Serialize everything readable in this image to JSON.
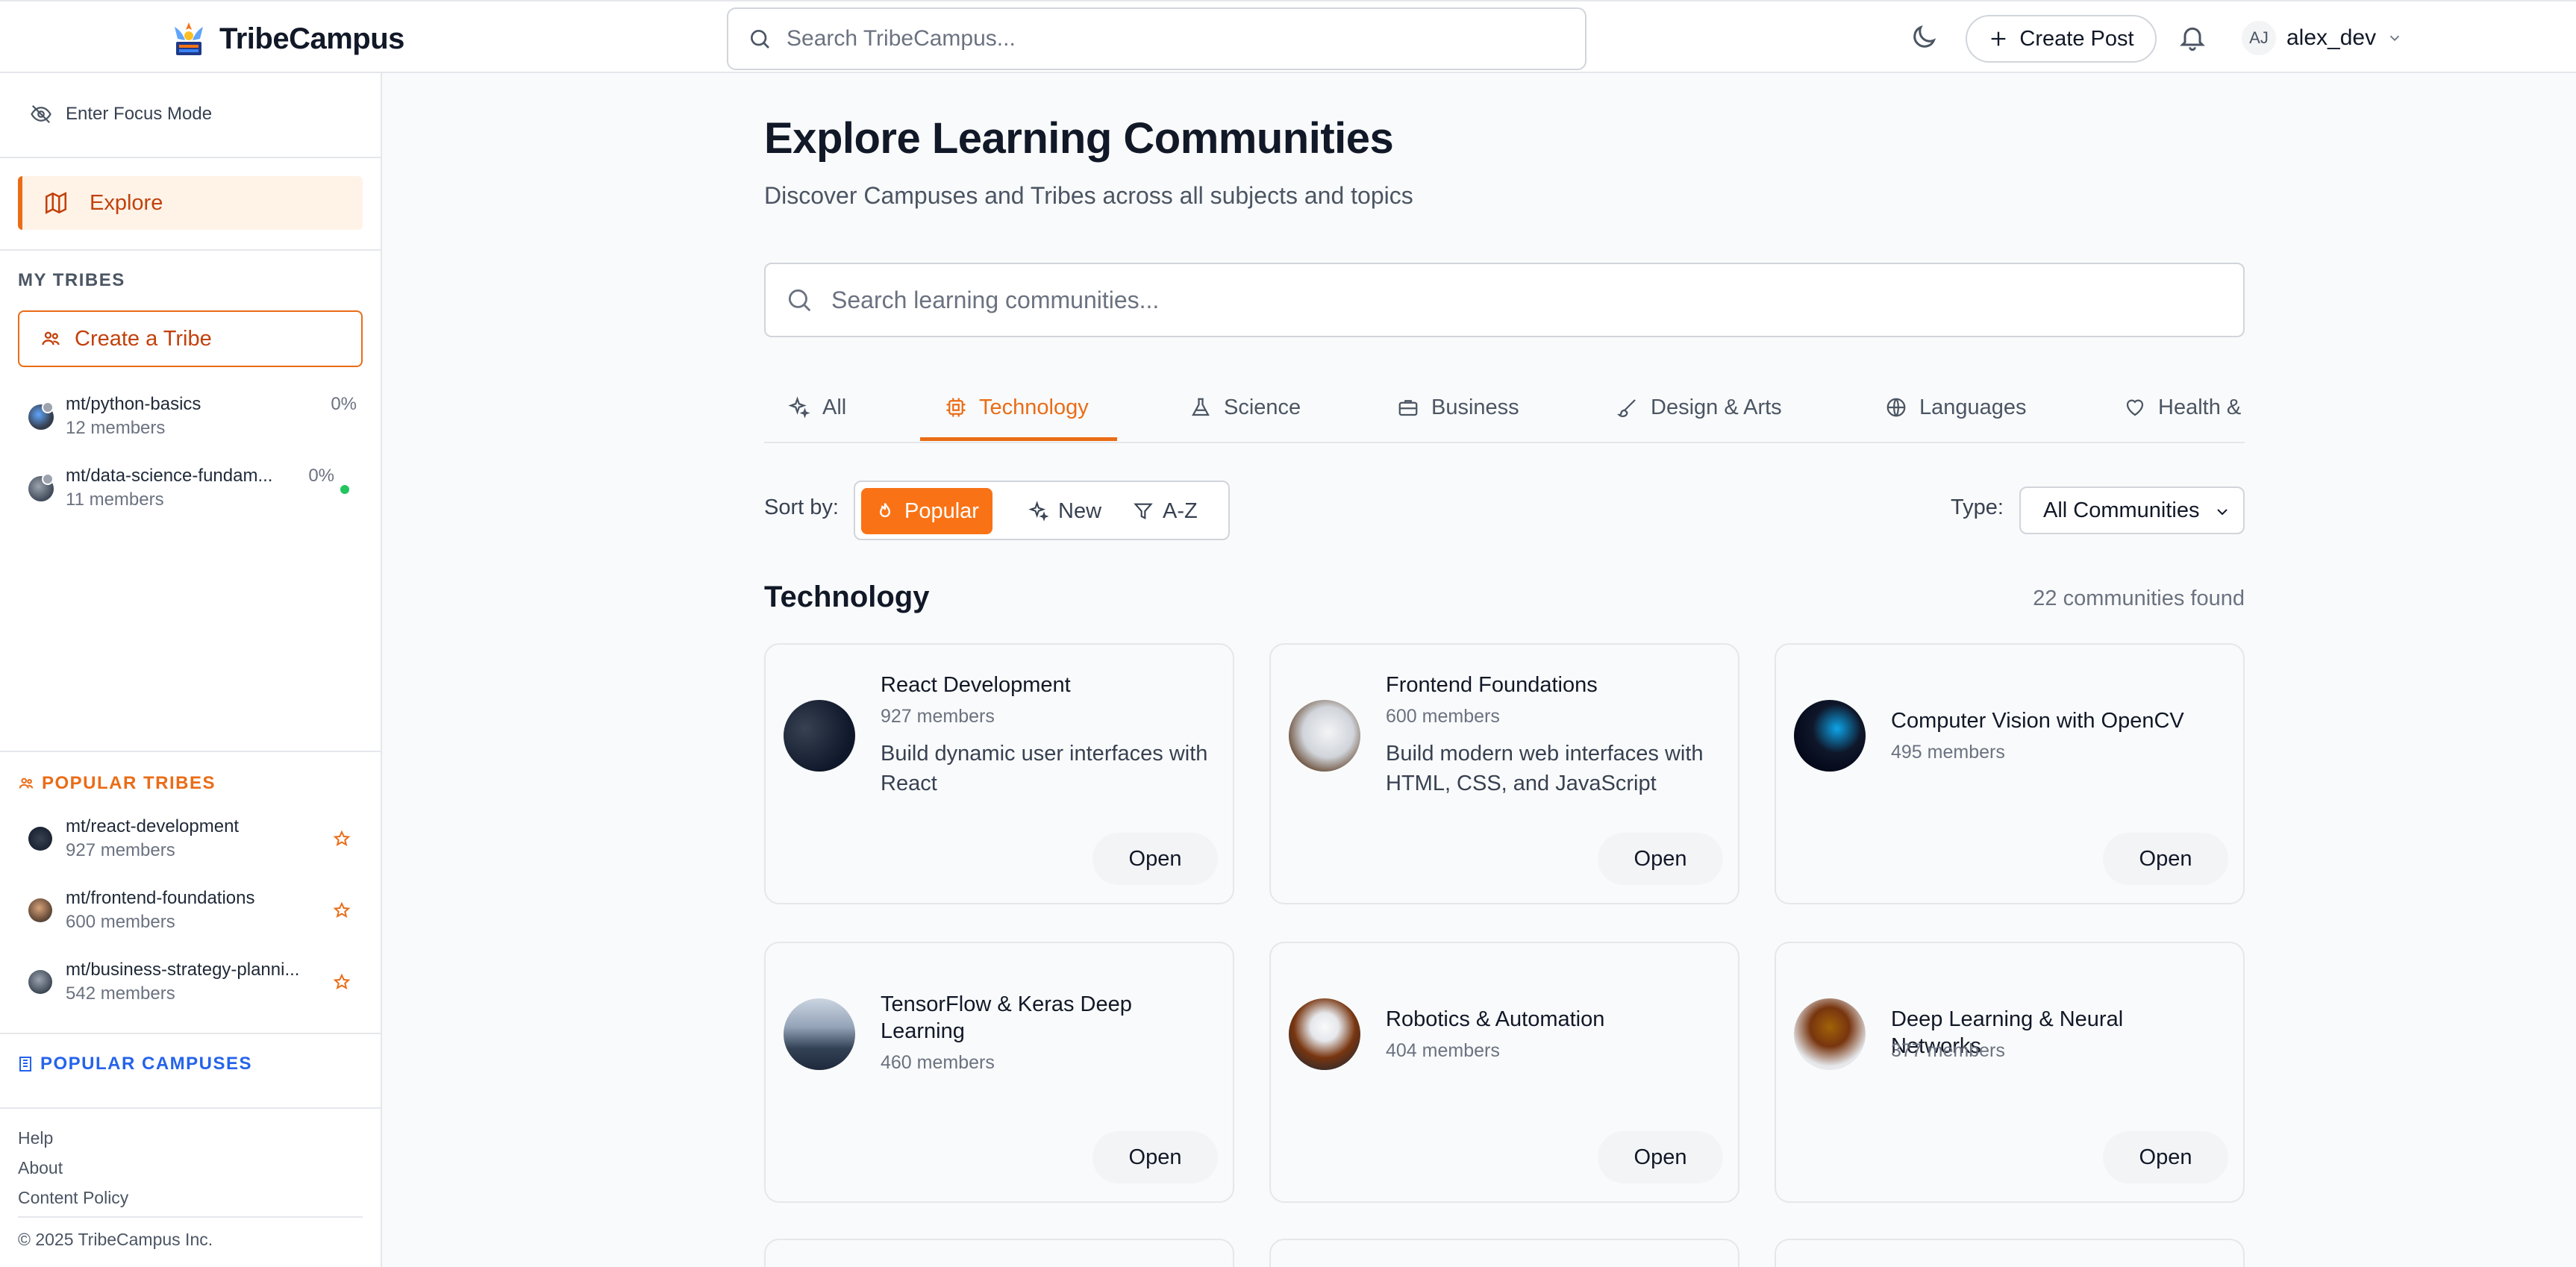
{
  "app": {
    "name": "TribeCampus",
    "search_placeholder": "Search TribeCampus...",
    "create_post": "Create Post",
    "user_initials": "AJ",
    "username": "alex_dev"
  },
  "sidebar": {
    "focus_mode": "Enter Focus Mode",
    "explore": "Explore",
    "my_tribes_label": "MY TRIBES",
    "create_tribe": "Create a Tribe",
    "my_tribes": [
      {
        "name": "mt/python-basics",
        "members": "12 members",
        "progress": "0%",
        "online": false
      },
      {
        "name": "mt/data-science-fundam...",
        "members": "11 members",
        "progress": "0%",
        "online": true
      }
    ],
    "popular_tribes_label": "POPULAR TRIBES",
    "popular_tribes": [
      {
        "name": "mt/react-development",
        "members": "927 members"
      },
      {
        "name": "mt/frontend-foundations",
        "members": "600 members"
      },
      {
        "name": "mt/business-strategy-planni...",
        "members": "542 members"
      }
    ],
    "popular_campuses_label": "POPULAR CAMPUSES",
    "footer_links": [
      "Help",
      "About",
      "Content Policy"
    ],
    "copyright": "© 2025 TribeCampus Inc."
  },
  "main": {
    "title": "Explore Learning Communities",
    "subtitle": "Discover Campuses and Tribes across all subjects and topics",
    "search_placeholder": "Search learning communities...",
    "tabs": [
      {
        "label": "All",
        "icon": "sparkles-icon",
        "active": false
      },
      {
        "label": "Technology",
        "icon": "cpu-icon",
        "active": true
      },
      {
        "label": "Science",
        "icon": "flask-icon",
        "active": false
      },
      {
        "label": "Business",
        "icon": "briefcase-icon",
        "active": false
      },
      {
        "label": "Design & Arts",
        "icon": "brush-icon",
        "active": false
      },
      {
        "label": "Languages",
        "icon": "globe-icon",
        "active": false
      },
      {
        "label": "Health &",
        "icon": "heart-icon",
        "active": false
      }
    ],
    "sort_label": "Sort by:",
    "sort_options": [
      {
        "label": "Popular",
        "active": true
      },
      {
        "label": "New",
        "active": false
      },
      {
        "label": "A-Z",
        "active": false
      }
    ],
    "type_label": "Type:",
    "type_value": "All Communities",
    "section_title": "Technology",
    "found_count": "22 communities found",
    "open_label": "Open",
    "cards": [
      {
        "title": "React Development",
        "members": "927 members",
        "description": "Build dynamic user interfaces with React"
      },
      {
        "title": "Frontend Foundations",
        "members": "600 members",
        "description": "Build modern web interfaces with HTML, CSS, and JavaScript"
      },
      {
        "title": "Computer Vision with OpenCV",
        "members": "495 members",
        "description": ""
      },
      {
        "title": "TensorFlow & Keras Deep Learning",
        "members": "460 members",
        "description": ""
      },
      {
        "title": "Robotics & Automation",
        "members": "404 members",
        "description": ""
      },
      {
        "title": "Deep Learning & Neural Networks",
        "members": "377 members",
        "description": ""
      }
    ]
  },
  "colors": {
    "accent": "#ea6c16",
    "accent_bg": "#fff3e8",
    "campus_blue": "#2563eb",
    "online_green": "#22c55e"
  }
}
